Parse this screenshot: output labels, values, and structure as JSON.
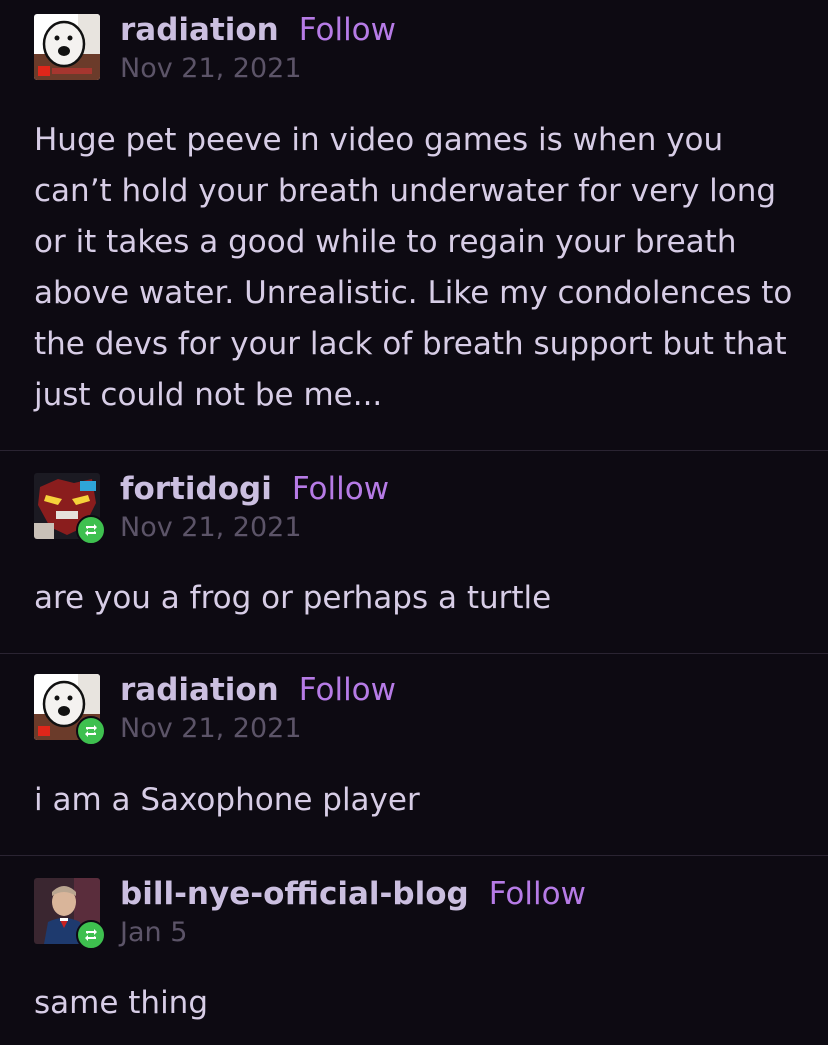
{
  "posts": [
    {
      "username": "radiation",
      "follow_label": "Follow",
      "date": "Nov 21, 2021",
      "reblogged": false,
      "avatar": "radiation-avatar",
      "text": "Huge pet peeve in video games is when you can’t hold your breath underwater for very long or it takes a good while to regain your breath above water. Unrealistic. Like my condolences to the devs for your lack of breath support but that just could not be me..."
    },
    {
      "username": "fortidogi",
      "follow_label": "Follow",
      "date": "Nov 21, 2021",
      "reblogged": true,
      "avatar": "fortidogi-avatar",
      "text": "are you a frog or perhaps a turtle"
    },
    {
      "username": "radiation",
      "follow_label": "Follow",
      "date": "Nov 21, 2021",
      "reblogged": true,
      "avatar": "radiation-avatar",
      "text": "i am a Saxophone player"
    },
    {
      "username": "bill-nye-official-blog",
      "follow_label": "Follow",
      "date": "Jan 5",
      "reblogged": true,
      "avatar": "bill-nye-avatar",
      "text": "same thing"
    }
  ],
  "colors": {
    "background": "#0d0a12",
    "username": "#cbbfe0",
    "follow": "#b67be6",
    "date": "#5c5468",
    "body": "#d7cde6",
    "reblog_badge": "#3ec04f"
  }
}
